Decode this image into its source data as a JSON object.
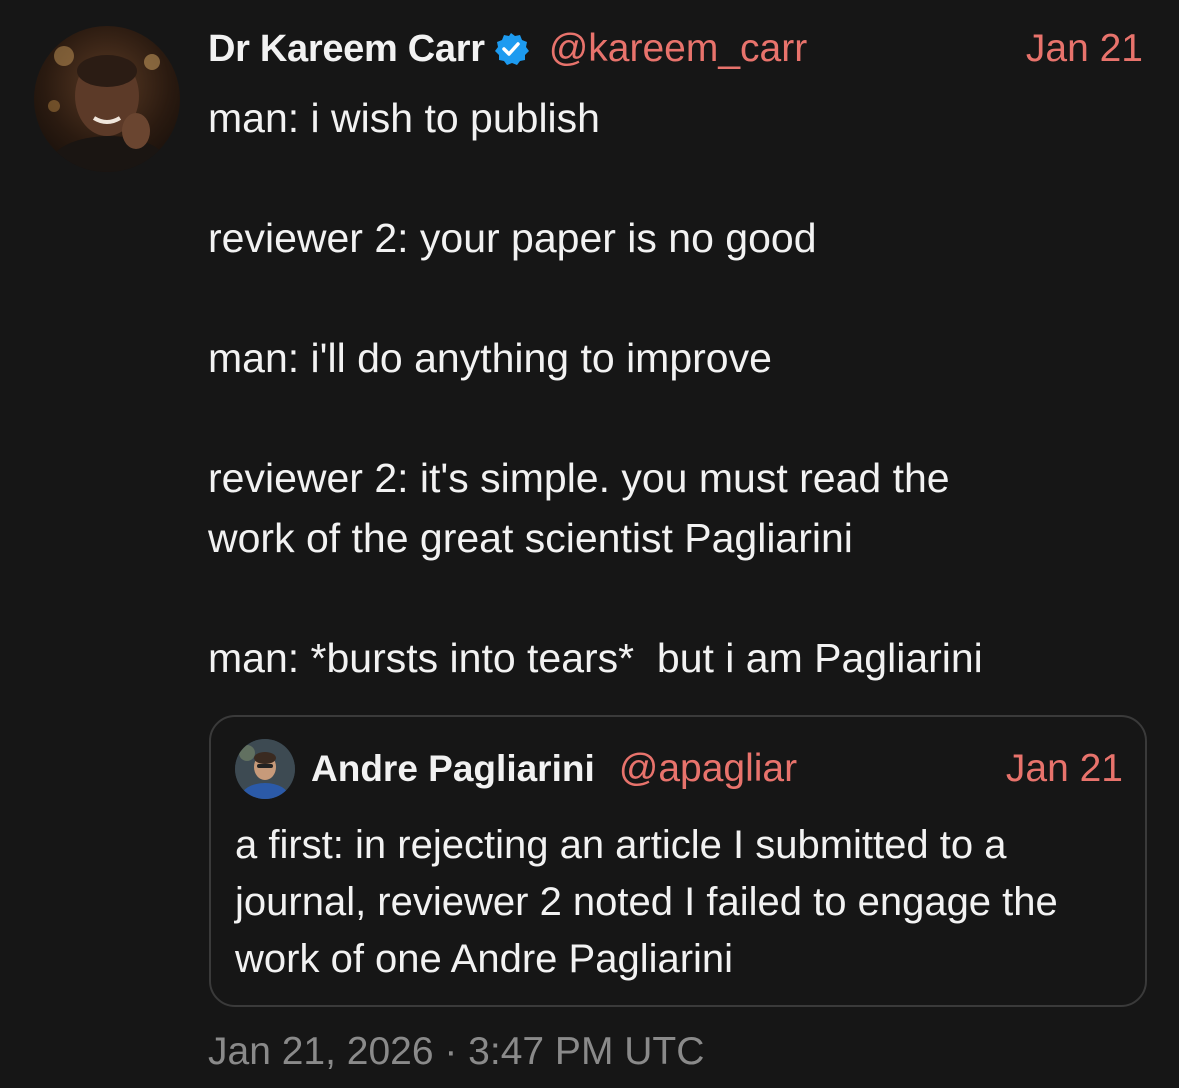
{
  "tweet": {
    "author": {
      "display_name": "Dr Kareem Carr",
      "handle": "@kareem_carr",
      "verified_icon": "verified-badge-icon",
      "avatar": "avatar-photo"
    },
    "date": "Jan 21",
    "text": "man: i wish to publish\n\nreviewer 2: your paper is no good\n\nman: i'll do anything to improve\n\nreviewer 2: it's simple. you must read the\nwork of the great scientist Pagliarini\n\nman: *bursts into tears*  but i am Pagliarini",
    "footer_timestamp": "Jan 21, 2026 · 3:47 PM UTC"
  },
  "quoted_tweet": {
    "author": {
      "display_name": "Andre Pagliarini",
      "handle": "@apagliar",
      "avatar": "avatar-photo"
    },
    "date": "Jan 21",
    "text": "a first: in rejecting an article I submitted to a journal, reviewer 2 noted I failed to engage the work of one Andre Pagliarini"
  },
  "colors": {
    "background": "#161616",
    "text": "#f2f2f2",
    "accent": "#e8736c",
    "muted": "#8a8a8a",
    "verified": "#1d9bf0",
    "border": "#3a3a3a"
  }
}
